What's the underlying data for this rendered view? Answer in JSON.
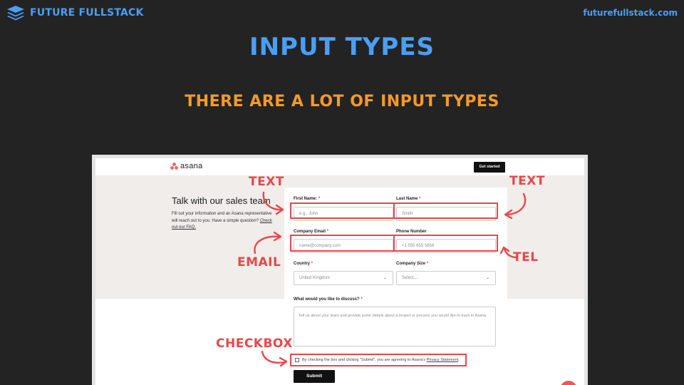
{
  "header": {
    "brand_name": "FUTURE FULLSTACK",
    "site_url": "futurefullstack.com",
    "logo_icon": "layers-stack-icon"
  },
  "slide": {
    "title": "INPUT TYPES",
    "subtitle": "THERE ARE A LOT OF INPUT TYPES"
  },
  "colors": {
    "background": "#232323",
    "brand_blue": "#4a9ff5",
    "subtitle_orange": "#f39a2c",
    "annotation_red": "#e8474a",
    "asana_coral": "#f06a6a"
  },
  "screenshot": {
    "logo_text": "asana",
    "get_started": "Get started",
    "hero_title": "Talk with our sales team",
    "hero_text": "Fill out your information and an Asana representative will reach out to you. Have a simple question? ",
    "hero_link": "Check out our FAQ.",
    "form": {
      "first_name": {
        "label": "First Name: ",
        "placeholder": "e.g., John"
      },
      "last_name": {
        "label": "Last Name ",
        "placeholder": "Smith"
      },
      "company_email": {
        "label": "Company Email ",
        "placeholder": "name@company.com"
      },
      "phone": {
        "label": "Phone Number",
        "placeholder": "+1 555 655 5656"
      },
      "country": {
        "label": "Country ",
        "value": "United Kingdom"
      },
      "company_size": {
        "label": "Company Size ",
        "value": "Select..."
      },
      "discuss": {
        "label": "What would you like to discuss? ",
        "placeholder": "Tell us about your team and provide some details about a project or process you would like to track in Asana."
      },
      "consent_text": "By checking the box and clicking \"Submit\", you are agreeing to Asana's ",
      "consent_link": "Privacy Statement",
      "consent_end": ".",
      "required_mark": "*",
      "submit": "Submit"
    }
  },
  "annotations": {
    "text_left": "TEXT",
    "text_right": "TEXT",
    "email": "EMAIL",
    "tel": "TEL",
    "checkbox": "CHECKBOX"
  }
}
